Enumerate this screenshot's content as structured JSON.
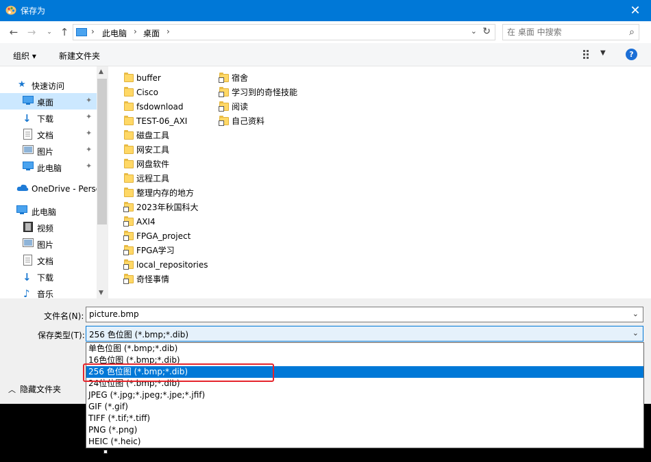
{
  "window": {
    "title": "保存为",
    "close_glyph": "✕"
  },
  "address": {
    "crumbs": [
      "此电脑",
      "桌面"
    ],
    "search_placeholder": "在 桌面 中搜索"
  },
  "toolbar": {
    "organize_label": "组织 ▾",
    "new_folder_label": "新建文件夹",
    "help_label": "?"
  },
  "nav": {
    "items": [
      {
        "label": "快速访问",
        "icon": "star-icon"
      },
      {
        "label": "桌面",
        "icon": "desktop-icon",
        "pinned": true,
        "selected": true
      },
      {
        "label": "下载",
        "icon": "download-icon",
        "pinned": true
      },
      {
        "label": "文档",
        "icon": "document-icon",
        "pinned": true
      },
      {
        "label": "图片",
        "icon": "picture-icon",
        "pinned": true
      },
      {
        "label": "此电脑",
        "icon": "computer-icon",
        "pinned": true
      },
      {
        "label": "OneDrive - Perso",
        "icon": "cloud-icon"
      },
      {
        "label": "此电脑",
        "icon": "computer-icon"
      },
      {
        "label": "视频",
        "icon": "video-icon"
      },
      {
        "label": "图片",
        "icon": "picture-icon"
      },
      {
        "label": "文档",
        "icon": "document-icon"
      },
      {
        "label": "下载",
        "icon": "download-icon"
      },
      {
        "label": "音乐",
        "icon": "music-icon"
      }
    ]
  },
  "files": {
    "col1": [
      {
        "name": "buffer",
        "shortcut": false
      },
      {
        "name": "Cisco",
        "shortcut": false
      },
      {
        "name": "fsdownload",
        "shortcut": false
      },
      {
        "name": "TEST-06_AXI",
        "shortcut": false
      },
      {
        "name": "磁盘工具",
        "shortcut": false
      },
      {
        "name": "网安工具",
        "shortcut": false
      },
      {
        "name": "网盘软件",
        "shortcut": false
      },
      {
        "name": "远程工具",
        "shortcut": false
      },
      {
        "name": "整理内存的地方",
        "shortcut": false
      },
      {
        "name": "2023年秋国科大",
        "shortcut": true
      },
      {
        "name": "AXI4",
        "shortcut": true
      },
      {
        "name": "FPGA_project",
        "shortcut": true
      },
      {
        "name": "FPGA学习",
        "shortcut": true
      },
      {
        "name": "local_repositories",
        "shortcut": true
      },
      {
        "name": "奇怪事情",
        "shortcut": true
      }
    ],
    "col2": [
      {
        "name": "宿舍",
        "shortcut": true
      },
      {
        "name": "学习到的奇怪技能",
        "shortcut": true
      },
      {
        "name": "阅读",
        "shortcut": true
      },
      {
        "name": "自己资料",
        "shortcut": true
      }
    ]
  },
  "form": {
    "filename_label": "文件名(N):",
    "filename_value": "picture.bmp",
    "filetype_label": "保存类型(T):",
    "filetype_value": "256 色位图 (*.bmp;*.dib)",
    "hide_folders_label": "隐藏文件夹"
  },
  "filetype_options": [
    "单色位图 (*.bmp;*.dib)",
    "16色位图 (*.bmp;*.dib)",
    "256 色位图 (*.bmp;*.dib)",
    "24位位图 (*.bmp;*.dib)",
    "JPEG (*.jpg;*.jpeg;*.jpe;*.jfif)",
    "GIF (*.gif)",
    "TIFF (*.tif;*.tiff)",
    "PNG (*.png)",
    "HEIC (*.heic)"
  ],
  "selected_option_index": 2,
  "colors": {
    "accent": "#0078d7",
    "highlight_box": "#e5242b",
    "folder": "#ffd866"
  }
}
